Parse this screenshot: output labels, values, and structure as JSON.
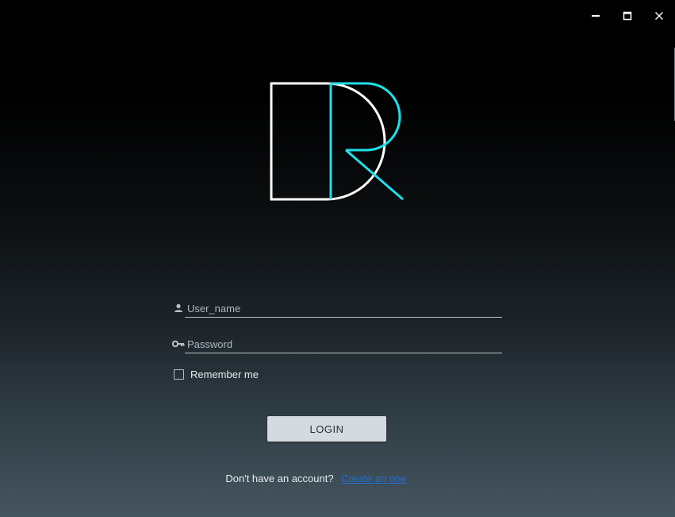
{
  "window": {
    "controls": {
      "minimize_icon": "minimize-icon",
      "maximize_icon": "maximize-icon",
      "close_icon": "close-icon"
    }
  },
  "logo": {
    "letters": "DR",
    "colors": {
      "d": "#ffffff",
      "r": "#1ee0ea"
    }
  },
  "login_form": {
    "username": {
      "placeholder": "User_name",
      "value": "",
      "icon": "user-icon"
    },
    "password": {
      "placeholder": "Password",
      "value": "",
      "icon": "key-icon"
    },
    "remember_label": "Remember me",
    "remember_checked": false,
    "login_label": "LOGIN"
  },
  "signup": {
    "prompt": "Don't have an account?",
    "link_label": "Create an one"
  },
  "colors": {
    "accent_cyan": "#1ee0ea",
    "link_blue": "#1f6fd6",
    "button_bg": "#d4dadf"
  }
}
